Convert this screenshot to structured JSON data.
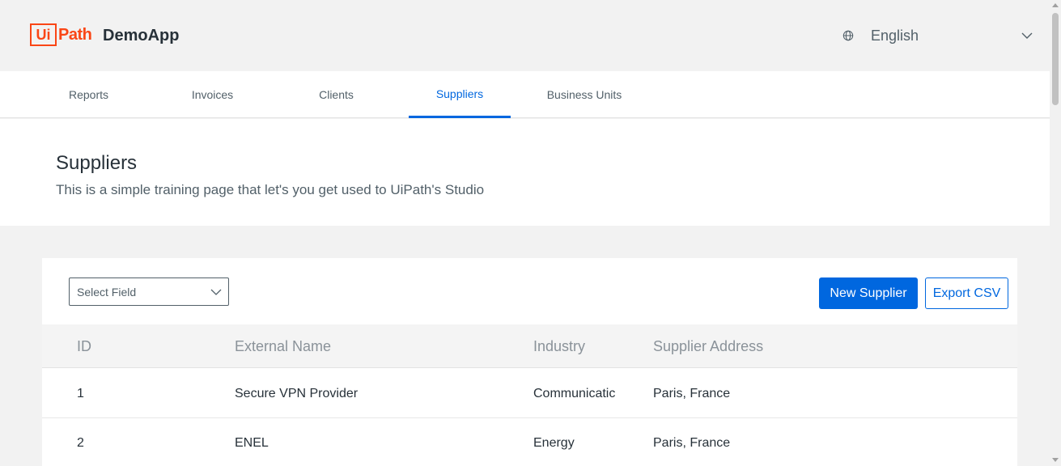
{
  "header": {
    "logo_ui": "Ui",
    "logo_path": "Path",
    "app_name": "DemoApp",
    "language": "English"
  },
  "nav": {
    "tabs": [
      {
        "label": "Reports",
        "active": false
      },
      {
        "label": "Invoices",
        "active": false
      },
      {
        "label": "Clients",
        "active": false
      },
      {
        "label": "Suppliers",
        "active": true
      },
      {
        "label": "Business Units",
        "active": false
      }
    ]
  },
  "page": {
    "title": "Suppliers",
    "subtitle": "This is a simple training page that let's you get used to UiPath's Studio"
  },
  "toolbar": {
    "select_placeholder": "Select Field",
    "new_label": "New Supplier",
    "export_label": "Export CSV"
  },
  "table": {
    "columns": [
      "ID",
      "External Name",
      "Industry",
      "Supplier Address"
    ],
    "rows": [
      [
        "1",
        "Secure VPN Provider",
        "Communicatic",
        "Paris, France"
      ],
      [
        "2",
        "ENEL",
        "Energy",
        "Paris, France"
      ]
    ]
  },
  "colors": {
    "accent": "#0067df",
    "brand": "#fa4616"
  }
}
